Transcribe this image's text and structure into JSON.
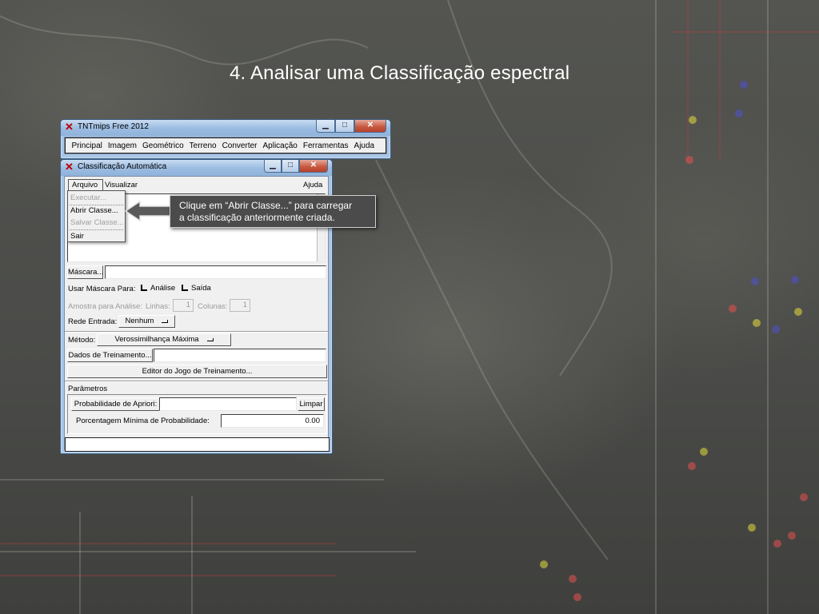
{
  "slide": {
    "title": "4. Analisar uma Classificação espectral"
  },
  "main_window": {
    "title": "TNTmips Free 2012",
    "menu": [
      "Principal",
      "Imagem",
      "Geométrico",
      "Terreno",
      "Converter",
      "Aplicação",
      "Ferramentas",
      "Ajuda"
    ]
  },
  "classification_window": {
    "title": "Classificação Automática",
    "menu": {
      "arquivo": "Arquivo",
      "visualizar": "Visualizar",
      "ajuda": "Ajuda"
    },
    "file_menu": {
      "items": [
        {
          "label": "Executar...",
          "enabled": false
        },
        {
          "label": "Abrir Classe...",
          "enabled": true
        },
        {
          "label": "Salvar Classe...",
          "enabled": false
        },
        {
          "label": "Sair",
          "enabled": true
        }
      ]
    },
    "mascara_button": "Máscara...",
    "mascara_value": "",
    "usar_mascara_label": "Usar Máscara Para:",
    "analise_label": "Análise",
    "saida_label": "Saída",
    "amostra_label": "Amostra para Análise:",
    "linhas_label": "Linhas:",
    "linhas_value": "1",
    "colunas_label": "Colunas:",
    "colunas_value": "1",
    "rede_label": "Rede Entrada:",
    "rede_value": "Nenhum",
    "metodo_label": "Método:",
    "metodo_value": "Verossimilhança Máxima",
    "dados_button": "Dados de Treinamento...",
    "dados_value": "",
    "editor_button": "Editor do Jogo de Treinamento...",
    "parametros_label": "Parâmetros",
    "probabilidade_label": "Probabilidade de Apriori:",
    "probabilidade_value": "",
    "limpar_button": "Limpar",
    "porcentagem_label": "Porcentagem Mínima de Probabilidade:",
    "porcentagem_value": "0.00",
    "status_value": ""
  },
  "callout": {
    "line1": "Clique em “Abrir Classe...” para carregar",
    "line2": "a classificação anteriormente criada."
  },
  "colors": {
    "background": "#4e4f4c",
    "window_frame": "#a9c6e6",
    "callout_bg": "#4b4b4b",
    "close_button": "#c75b43"
  }
}
